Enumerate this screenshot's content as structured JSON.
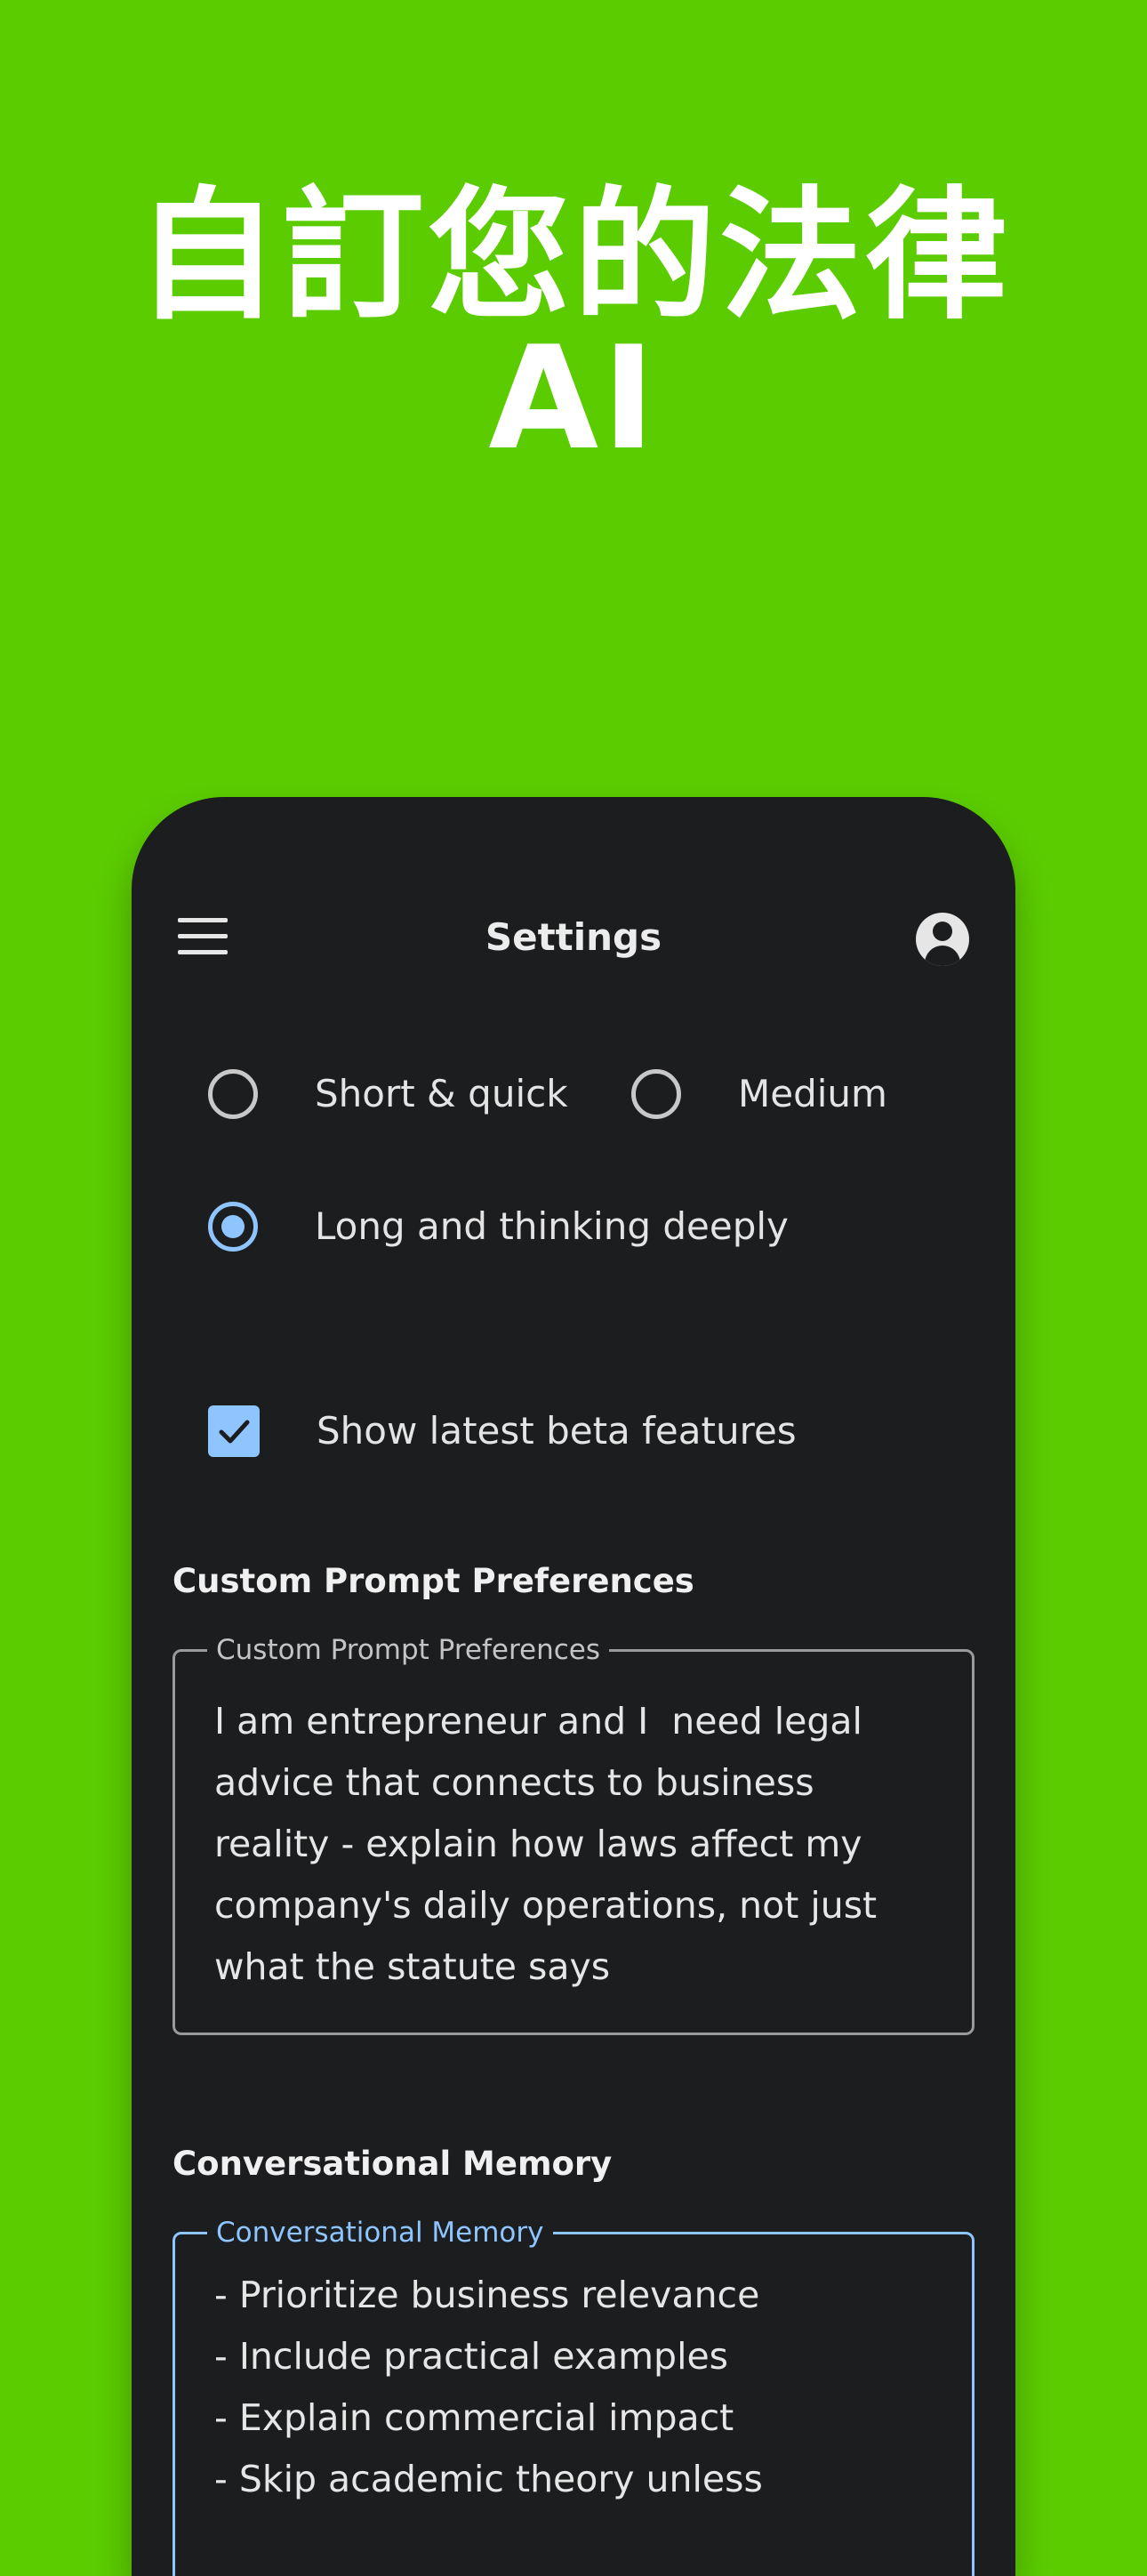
{
  "hero": {
    "title": "自訂您的法律 AI"
  },
  "appbar": {
    "title": "Settings",
    "menu_icon": "menu-icon",
    "account_icon": "account-circle-icon"
  },
  "response_length": {
    "options": [
      {
        "label": "Short & quick",
        "selected": false
      },
      {
        "label": "Medium",
        "selected": false
      },
      {
        "label": "Long and thinking deeply",
        "selected": true
      }
    ]
  },
  "beta": {
    "label": "Show latest beta features",
    "checked": true
  },
  "custom_prompt": {
    "section_title": "Custom Prompt Preferences",
    "field_label": "Custom Prompt Preferences",
    "value": "I am entrepreneur and I  need legal\nadvice that connects to business\nreality - explain how laws affect my\ncompany's daily operations, not just\nwhat the statute says"
  },
  "memory": {
    "section_title": "Conversational Memory",
    "field_label": "Conversational Memory",
    "value": "- Prioritize business relevance\n- Include practical examples\n- Explain commercial impact\n- Skip academic theory unless"
  },
  "colors": {
    "background": "#5bcc00",
    "surface": "#1c1d1f",
    "accent": "#8ec5ff"
  }
}
